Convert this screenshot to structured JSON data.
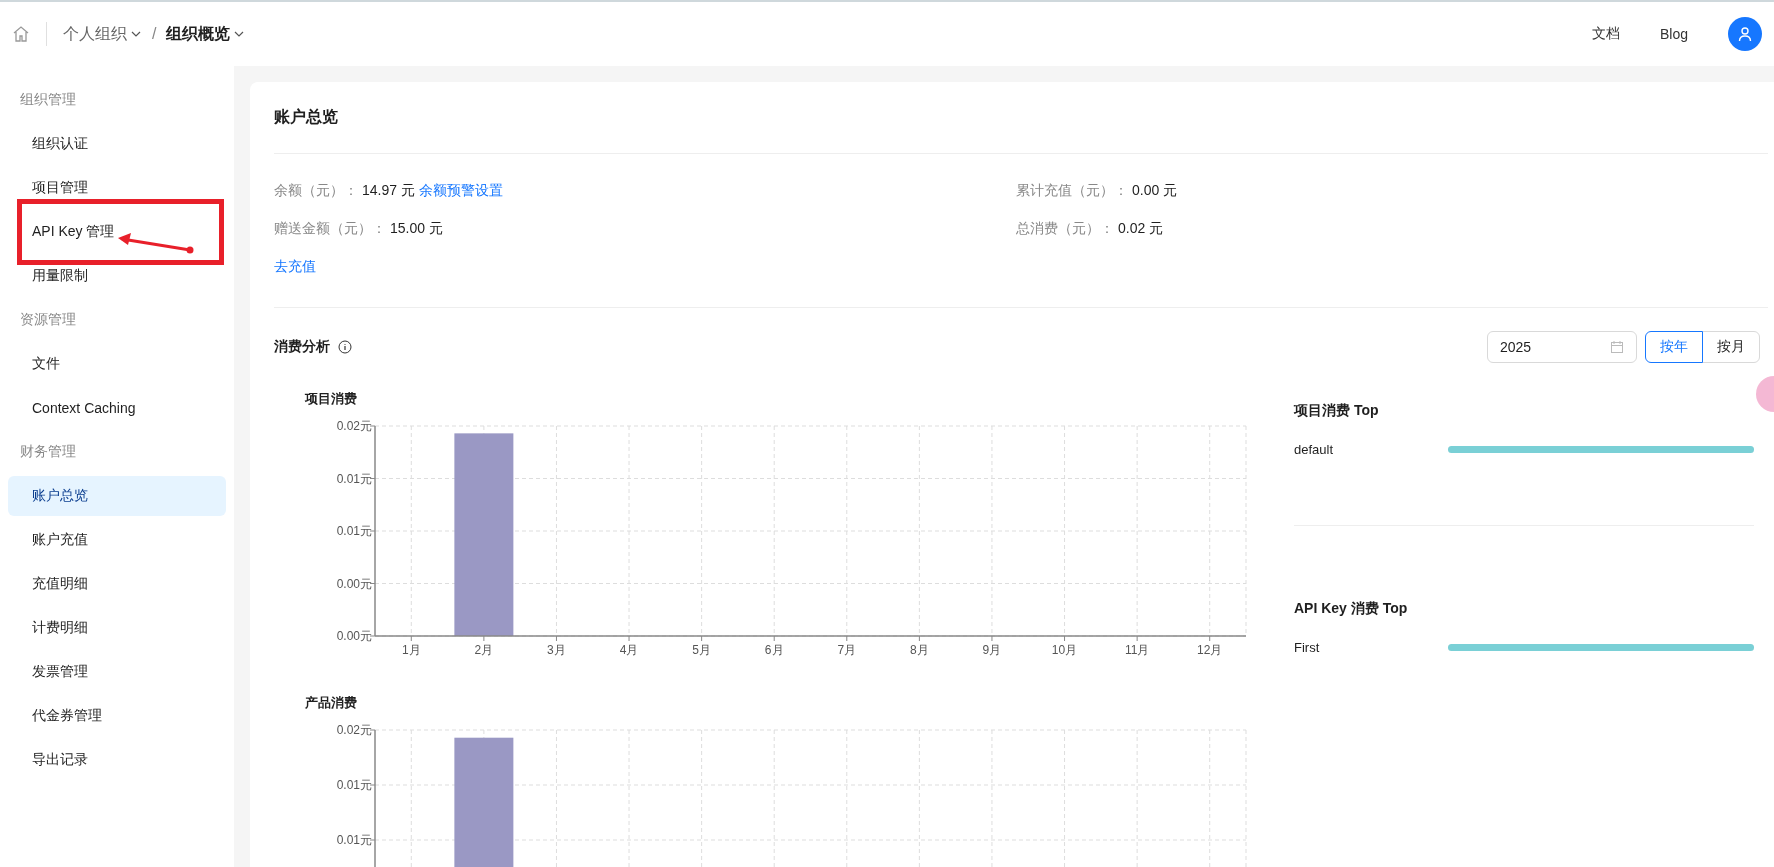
{
  "header": {
    "separator": "/",
    "breadcrumbs": [
      {
        "label": "个人组织",
        "selected": false
      },
      {
        "label": "组织概览",
        "selected": true
      }
    ],
    "links": [
      "文档",
      "Blog"
    ]
  },
  "sidebar": {
    "groups": [
      {
        "label": "组织管理",
        "items": [
          {
            "label": "组织认证",
            "selected": false
          },
          {
            "label": "项目管理",
            "selected": false
          },
          {
            "label": "API Key 管理",
            "selected": false
          },
          {
            "label": "用量限制",
            "selected": false
          }
        ]
      },
      {
        "label": "资源管理",
        "items": [
          {
            "label": "文件",
            "selected": false
          },
          {
            "label": "Context Caching",
            "selected": false
          }
        ]
      },
      {
        "label": "财务管理",
        "items": [
          {
            "label": "账户总览",
            "selected": true
          },
          {
            "label": "账户充值",
            "selected": false
          },
          {
            "label": "充值明细",
            "selected": false
          },
          {
            "label": "计费明细",
            "selected": false
          },
          {
            "label": "发票管理",
            "selected": false
          },
          {
            "label": "代金券管理",
            "selected": false
          },
          {
            "label": "导出记录",
            "selected": false
          }
        ]
      }
    ]
  },
  "overview": {
    "title": "账户总览",
    "left": [
      {
        "label": "余额（元）：",
        "value": "14.97 元",
        "link": "余额预警设置"
      },
      {
        "label": "赠送金额（元）：",
        "value": "15.00 元"
      }
    ],
    "right": [
      {
        "label": "累计充值（元）：",
        "value": "0.00 元"
      },
      {
        "label": "总消费（元）：",
        "value": "0.02 元"
      }
    ],
    "recharge_link": "去充值"
  },
  "analysis": {
    "title": "消费分析",
    "year": "2025",
    "modes": [
      {
        "label": "按年",
        "selected": true
      },
      {
        "label": "按月",
        "selected": false
      }
    ],
    "charts": [
      {
        "chart_data": {
          "type": "bar",
          "title": "项目消费",
          "categories": [
            "1月",
            "2月",
            "3月",
            "4月",
            "5月",
            "6月",
            "7月",
            "8月",
            "9月",
            "10月",
            "11月",
            "12月"
          ],
          "values": [
            0,
            0.0193,
            0,
            0,
            0,
            0,
            0,
            0,
            0,
            0,
            0,
            0
          ],
          "grid": true,
          "ylim": [
            0,
            0.02
          ],
          "yticks": [
            {
              "value": 0,
              "label": "0.00元"
            },
            {
              "value": 0.005,
              "label": "0.00元"
            },
            {
              "value": 0.01,
              "label": "0.01元"
            },
            {
              "value": 0.015,
              "label": "0.01元"
            },
            {
              "value": 0.02,
              "label": "0.02元"
            }
          ]
        }
      },
      {
        "chart_data": {
          "type": "bar",
          "title": "产品消费",
          "values": [
            0,
            0.0193,
            0,
            0,
            0,
            0,
            0,
            0,
            0,
            0,
            0,
            0
          ],
          "grid": true,
          "ylim": [
            0,
            0.02
          ],
          "yticks": [
            {
              "value": 0.01,
              "label": "0.01元"
            },
            {
              "value": 0.015,
              "label": "0.01元"
            },
            {
              "value": 0.02,
              "label": "0.02元"
            }
          ]
        }
      }
    ],
    "tops": [
      {
        "title": "项目消费 Top",
        "rows": [
          {
            "name": "default",
            "level": 1
          }
        ]
      },
      {
        "title": "API Key 消费 Top",
        "rows": [
          {
            "name": "First",
            "level": 1
          }
        ]
      }
    ]
  }
}
